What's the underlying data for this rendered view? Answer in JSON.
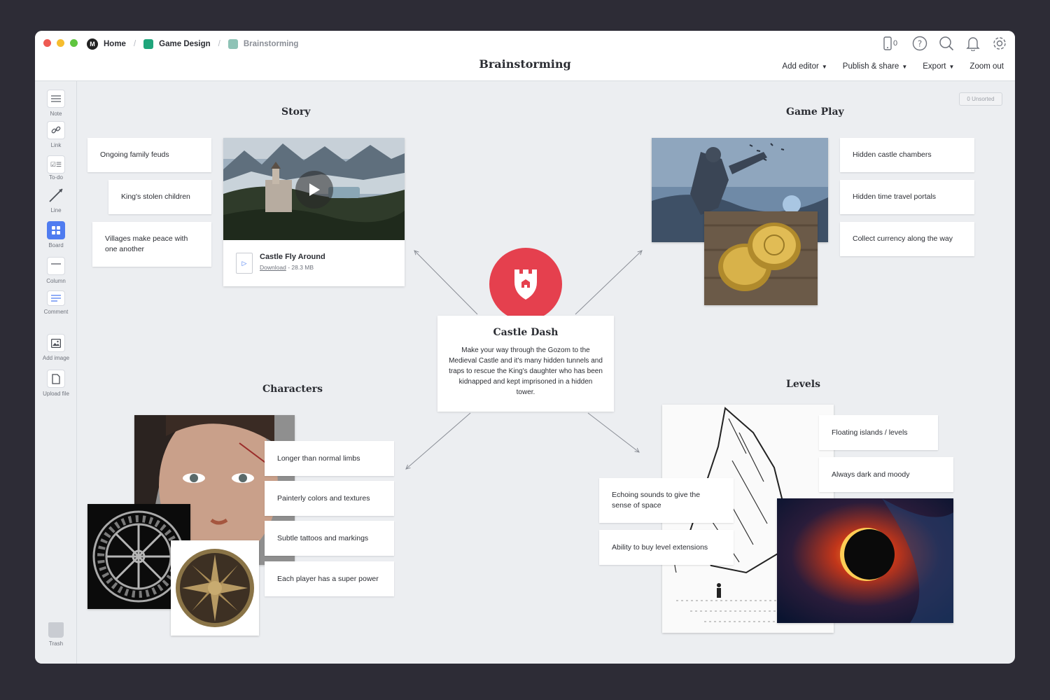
{
  "window": {
    "traffic_lights": [
      "#ee5a52",
      "#f6bd2f",
      "#5fc53f"
    ]
  },
  "breadcrumb": {
    "home": "Home",
    "project": "Game Design",
    "board": "Brainstorming",
    "project_color": "#1fa57b",
    "board_color": "#8ec3b6"
  },
  "header": {
    "title": "Brainstorming",
    "device_count": "0",
    "menu": {
      "add_editor": "Add editor",
      "publish_share": "Publish & share",
      "export": "Export",
      "zoom_out": "Zoom out"
    }
  },
  "sidebar": {
    "note": "Note",
    "link": "Link",
    "todo": "To-do",
    "line": "Line",
    "board": "Board",
    "column": "Column",
    "comment": "Comment",
    "add_image": "Add image",
    "upload_file": "Upload file",
    "trash": "Trash"
  },
  "canvas": {
    "unsorted": "0 Unsorted",
    "sections": {
      "story": "Story",
      "gameplay": "Game Play",
      "characters": "Characters",
      "levels": "Levels"
    },
    "story_notes": [
      "Ongoing family feuds",
      "King's stolen children",
      "Villages make peace with one another"
    ],
    "video": {
      "name": "Castle Fly Around",
      "download": "Download",
      "size": "- 28.3 MB"
    },
    "center": {
      "title": "Castle Dash",
      "description": "Make your way through the Gozom to the Medieval Castle and it's many hidden tunnels and traps to rescue the King's daughter who has been kidnapped and kept imprisoned in a hidden tower.",
      "accent": "#e5404e"
    },
    "gameplay_notes": [
      "Hidden castle chambers",
      "Hidden time travel portals",
      "Collect currency along the way"
    ],
    "character_notes": [
      "Longer than normal limbs",
      "Painterly colors and textures",
      "Subtle tattoos and markings",
      "Each player has a super power"
    ],
    "levels_notes": [
      "Floating islands / levels",
      "Always dark and moody",
      "Echoing sounds to give the sense of space",
      "Ability to buy level extensions"
    ]
  }
}
